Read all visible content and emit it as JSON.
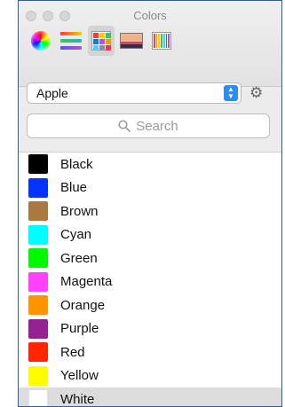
{
  "window": {
    "title": "Colors"
  },
  "toolbar": {
    "tools": [
      {
        "name": "color-wheel-tool",
        "icon": "color-wheel-icon"
      },
      {
        "name": "color-sliders-tool",
        "icon": "sliders-icon"
      },
      {
        "name": "color-palettes-tool",
        "icon": "palette-grid-icon",
        "active": true
      },
      {
        "name": "image-palettes-tool",
        "icon": "image-icon"
      },
      {
        "name": "pencils-tool",
        "icon": "crayons-icon"
      }
    ]
  },
  "palette_selector": {
    "value": "Apple"
  },
  "search": {
    "placeholder": "Search"
  },
  "colors": [
    {
      "name": "Black",
      "hex": "#000000"
    },
    {
      "name": "Blue",
      "hex": "#0433ff"
    },
    {
      "name": "Brown",
      "hex": "#aa7942"
    },
    {
      "name": "Cyan",
      "hex": "#00fdff"
    },
    {
      "name": "Green",
      "hex": "#00f900"
    },
    {
      "name": "Magenta",
      "hex": "#ff40ff"
    },
    {
      "name": "Orange",
      "hex": "#ff9300"
    },
    {
      "name": "Purple",
      "hex": "#942192"
    },
    {
      "name": "Red",
      "hex": "#ff2600"
    },
    {
      "name": "Yellow",
      "hex": "#fffb00"
    },
    {
      "name": "White",
      "hex": "#ffffff",
      "selected": true
    }
  ]
}
